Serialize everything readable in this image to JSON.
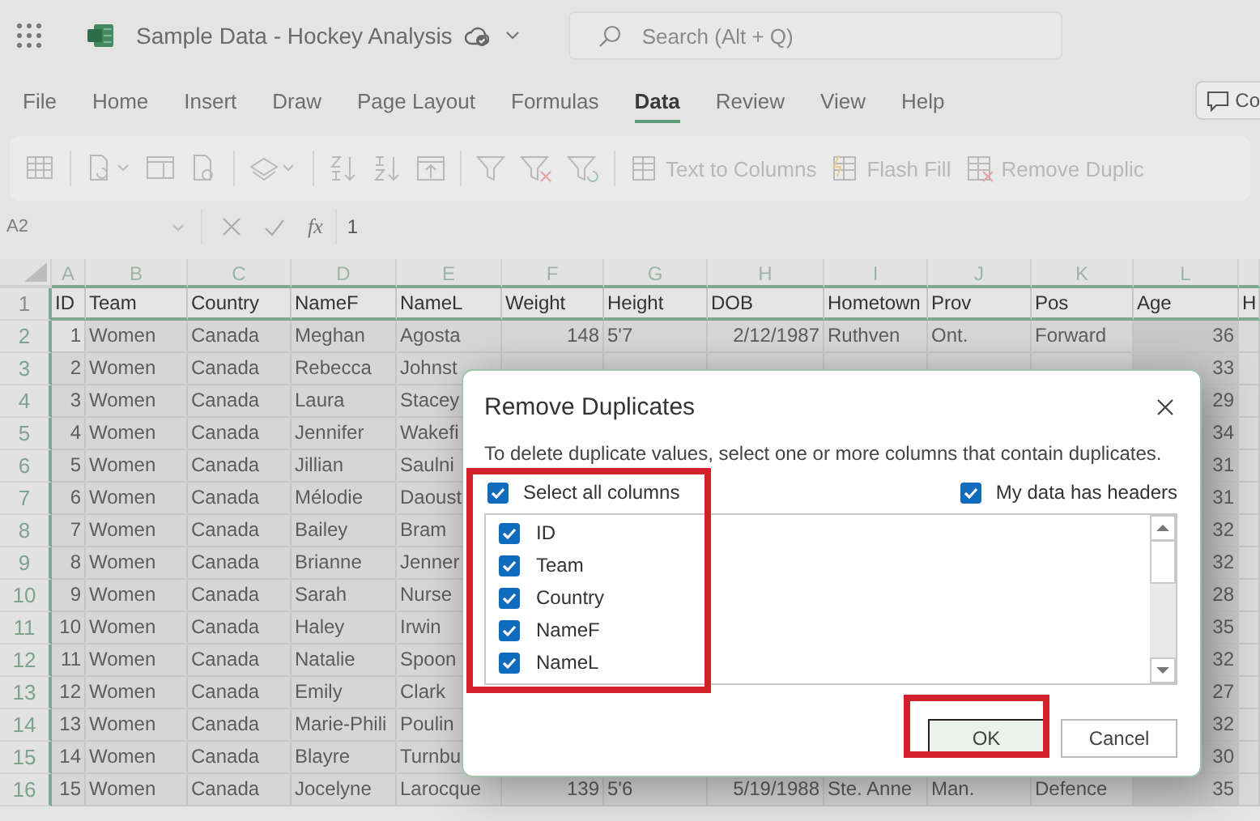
{
  "app_bar": {
    "title": "Sample Data - Hockey Analysis",
    "search": {
      "placeholder": "Search (Alt + Q)"
    }
  },
  "menu_tabs": [
    {
      "label": "File",
      "selected": false
    },
    {
      "label": "Home",
      "selected": false
    },
    {
      "label": "Insert",
      "selected": false
    },
    {
      "label": "Draw",
      "selected": false
    },
    {
      "label": "Page Layout",
      "selected": false
    },
    {
      "label": "Formulas",
      "selected": false
    },
    {
      "label": "Data",
      "selected": true
    },
    {
      "label": "Review",
      "selected": false
    },
    {
      "label": "View",
      "selected": false
    },
    {
      "label": "Help",
      "selected": false
    }
  ],
  "comments_button": {
    "label": "Co"
  },
  "ribbon": {
    "buttons": [
      {
        "label": "Text to Columns",
        "disabled": true
      },
      {
        "label": "Flash Fill",
        "disabled": true
      },
      {
        "label": "Remove Duplic",
        "disabled": true
      }
    ]
  },
  "formula_bar": {
    "name_box": "A2",
    "function_label": "fx",
    "formula": "1"
  },
  "sheet": {
    "columns": [
      "A",
      "B",
      "C",
      "D",
      "E",
      "F",
      "G",
      "H",
      "I",
      "J",
      "K",
      "L"
    ],
    "rows": [
      {
        "number": "1",
        "cells": {
          "id": "ID",
          "team": "Team",
          "country": "Country",
          "name_f": "NameF",
          "name_l": "NameL",
          "weight": "Weight",
          "height": "Height",
          "dob": "DOB",
          "hometown": "Hometown",
          "prov": "Prov",
          "pos": "Pos",
          "age": "Age",
          "column_13": "H"
        }
      },
      {
        "number": "2",
        "cells": {
          "id": "1",
          "team": "Women",
          "country": "Canada",
          "name_f": "Meghan",
          "name_l": "Agosta",
          "weight": "148",
          "height": "5'7",
          "dob": "2/12/1987",
          "hometown": "Ruthven",
          "prov": "Ont.",
          "pos": "Forward",
          "age": "36"
        }
      },
      {
        "number": "3",
        "cells": {
          "id": "2",
          "team": "Women",
          "country": "Canada",
          "name_f": "Rebecca",
          "name_l": "Johnst",
          "age": "33"
        }
      },
      {
        "number": "4",
        "cells": {
          "id": "3",
          "team": "Women",
          "country": "Canada",
          "name_f": "Laura",
          "name_l": "Stacey",
          "age": "29"
        }
      },
      {
        "number": "5",
        "cells": {
          "id": "4",
          "team": "Women",
          "country": "Canada",
          "name_f": "Jennifer",
          "name_l": "Wakefi",
          "age": "34"
        }
      },
      {
        "number": "6",
        "cells": {
          "id": "5",
          "team": "Women",
          "country": "Canada",
          "name_f": "Jillian",
          "name_l": "Saulni",
          "age": "31"
        }
      },
      {
        "number": "7",
        "cells": {
          "id": "6",
          "team": "Women",
          "country": "Canada",
          "name_f": "Mélodie",
          "name_l": "Daoust",
          "age": "31"
        }
      },
      {
        "number": "8",
        "cells": {
          "id": "7",
          "team": "Women",
          "country": "Canada",
          "name_f": "Bailey",
          "name_l": "Bram",
          "age": "32"
        }
      },
      {
        "number": "9",
        "cells": {
          "id": "8",
          "team": "Women",
          "country": "Canada",
          "name_f": "Brianne",
          "name_l": "Jenner",
          "age": "32"
        }
      },
      {
        "number": "10",
        "cells": {
          "id": "9",
          "team": "Women",
          "country": "Canada",
          "name_f": "Sarah",
          "name_l": "Nurse",
          "age": "28"
        }
      },
      {
        "number": "11",
        "cells": {
          "id": "10",
          "team": "Women",
          "country": "Canada",
          "name_f": "Haley",
          "name_l": "Irwin",
          "age": "35"
        }
      },
      {
        "number": "12",
        "cells": {
          "id": "11",
          "team": "Women",
          "country": "Canada",
          "name_f": "Natalie",
          "name_l": "Spoon",
          "age": "32"
        }
      },
      {
        "number": "13",
        "cells": {
          "id": "12",
          "team": "Women",
          "country": "Canada",
          "name_f": "Emily",
          "name_l": "Clark",
          "age": "27"
        }
      },
      {
        "number": "14",
        "cells": {
          "id": "13",
          "team": "Women",
          "country": "Canada",
          "name_f": "Marie-Phili",
          "name_l": "Poulin",
          "age": "32"
        }
      },
      {
        "number": "15",
        "cells": {
          "id": "14",
          "team": "Women",
          "country": "Canada",
          "name_f": "Blayre",
          "name_l": "Turnbu",
          "age": "30"
        }
      },
      {
        "number": "16",
        "cells": {
          "id": "15",
          "team": "Women",
          "country": "Canada",
          "name_f": "Jocelyne",
          "name_l": "Larocque",
          "weight": "139",
          "height": "5'6",
          "dob": "5/19/1988",
          "hometown": "Ste. Anne",
          "prov": "Man.",
          "pos": "Defence",
          "age": "35"
        }
      }
    ]
  },
  "dialog": {
    "title": "Remove Duplicates",
    "description": "To delete duplicate values, select one or more columns that contain duplicates.",
    "select_all": {
      "label": "Select all columns",
      "checked": true
    },
    "has_headers": {
      "label": "My data has headers",
      "checked": true
    },
    "column_selection_highlighted": true,
    "columns": [
      {
        "label": "ID",
        "checked": true
      },
      {
        "label": "Team",
        "checked": true
      },
      {
        "label": "Country",
        "checked": true
      },
      {
        "label": "NameF",
        "checked": true
      },
      {
        "label": "NameL",
        "checked": true
      }
    ],
    "buttons": [
      {
        "label": "OK",
        "default": true,
        "highlighted": true
      },
      {
        "label": "Cancel",
        "default": false,
        "highlighted": false
      }
    ]
  }
}
